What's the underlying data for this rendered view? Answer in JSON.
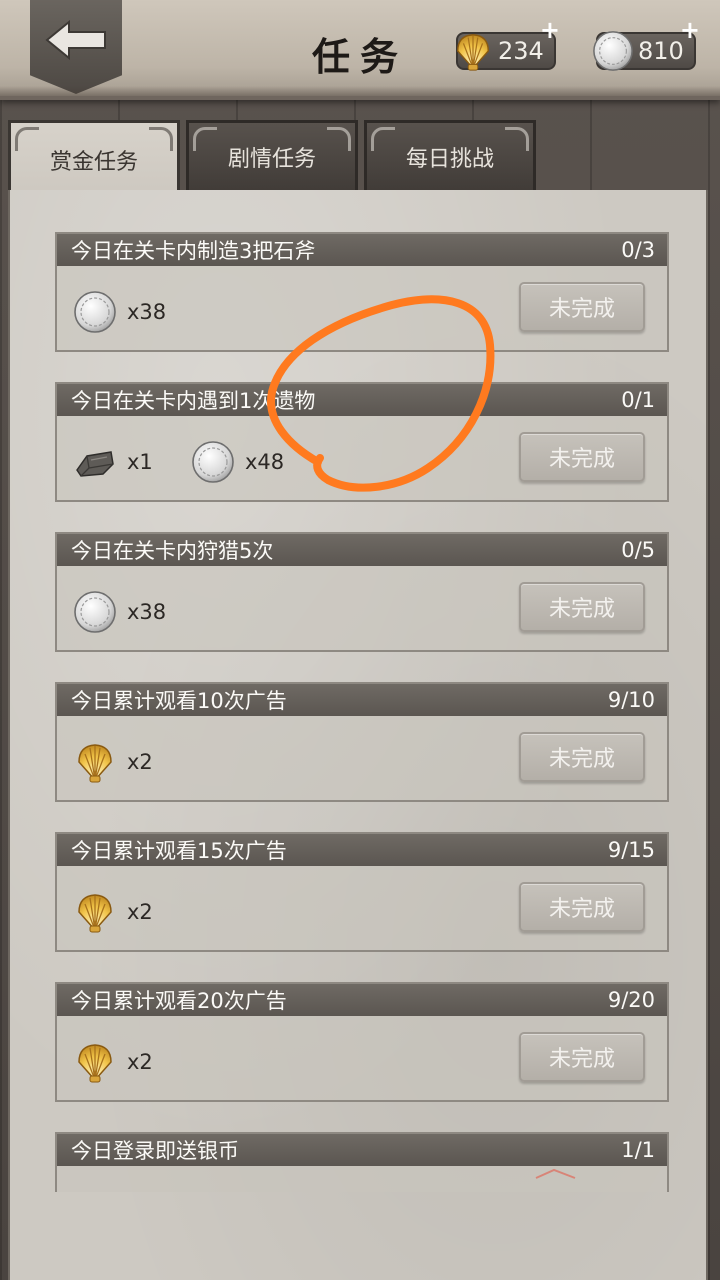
{
  "header": {
    "title": "任务",
    "back_icon": "arrow-left-icon",
    "shell": {
      "icon": "shell-icon",
      "value": "234",
      "plus": "+"
    },
    "silver": {
      "icon": "silver-coin-icon",
      "value": "810",
      "plus": "+"
    }
  },
  "tabs": [
    {
      "label": "赏金任务",
      "active": true
    },
    {
      "label": "剧情任务",
      "active": false
    },
    {
      "label": "每日挑战",
      "active": false
    }
  ],
  "tasks": [
    {
      "title": "今日在关卡内制造3把石斧",
      "progress": "0/3",
      "rewards": [
        {
          "icon": "silver-coin-icon",
          "amount": "x38"
        }
      ],
      "status": "未完成"
    },
    {
      "title": "今日在关卡内遇到1次遗物",
      "progress": "0/1",
      "rewards": [
        {
          "icon": "stone-material-icon",
          "amount": "x1"
        },
        {
          "icon": "silver-coin-icon",
          "amount": "x48"
        }
      ],
      "status": "未完成"
    },
    {
      "title": "今日在关卡内狩猎5次",
      "progress": "0/5",
      "rewards": [
        {
          "icon": "silver-coin-icon",
          "amount": "x38"
        }
      ],
      "status": "未完成"
    },
    {
      "title": "今日累计观看10次广告",
      "progress": "9/10",
      "rewards": [
        {
          "icon": "shell-icon",
          "amount": "x2"
        }
      ],
      "status": "未完成"
    },
    {
      "title": "今日累计观看15次广告",
      "progress": "9/15",
      "rewards": [
        {
          "icon": "shell-icon",
          "amount": "x2"
        }
      ],
      "status": "未完成"
    },
    {
      "title": "今日累计观看20次广告",
      "progress": "9/20",
      "rewards": [
        {
          "icon": "shell-icon",
          "amount": "x2"
        }
      ],
      "status": "未完成"
    },
    {
      "title": "今日登录即送银币",
      "progress": "1/1",
      "rewards": [],
      "status": ""
    }
  ],
  "colors": {
    "annotation": "#ff7a1f",
    "header_bar": "#5f5a55",
    "paper": "#cdc9c2"
  }
}
